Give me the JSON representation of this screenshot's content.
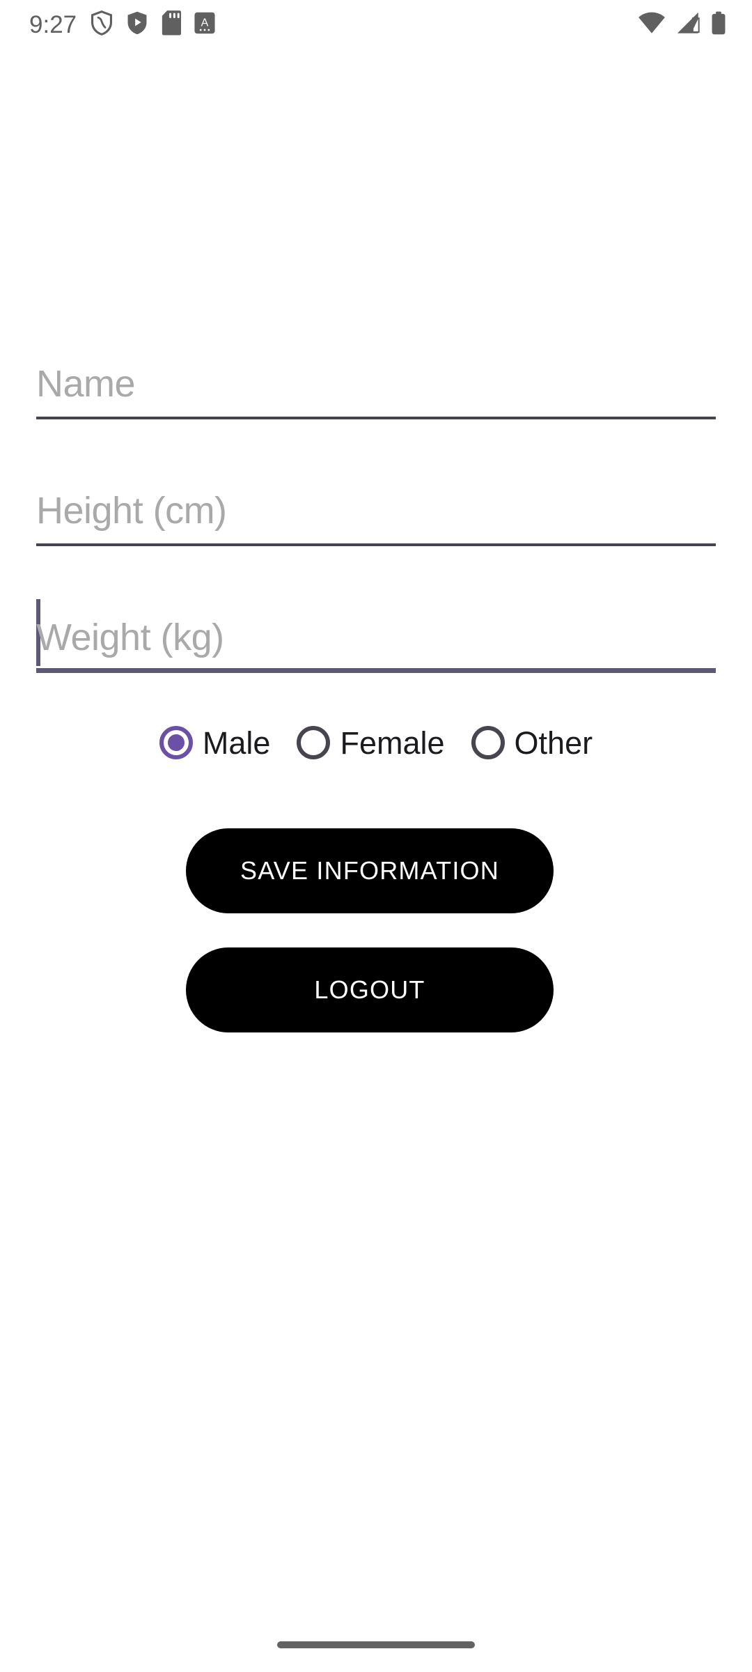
{
  "status_bar": {
    "time": "9:27",
    "left_icons": [
      {
        "name": "shield-outline-icon"
      },
      {
        "name": "shield-play-icon"
      },
      {
        "name": "sd-card-icon"
      },
      {
        "name": "document-a-icon"
      }
    ],
    "right_icons": [
      {
        "name": "wifi-icon"
      },
      {
        "name": "cellular-signal-icon"
      },
      {
        "name": "battery-icon"
      }
    ]
  },
  "form": {
    "fields": [
      {
        "id": "name",
        "placeholder": "Name",
        "value": "",
        "focused": false
      },
      {
        "id": "height",
        "placeholder": "Height (cm)",
        "value": "",
        "focused": false
      },
      {
        "id": "weight",
        "placeholder": "Weight (kg)",
        "value": "",
        "focused": true
      }
    ],
    "gender": {
      "selected": "Male",
      "options": [
        {
          "label": "Male",
          "selected": true
        },
        {
          "label": "Female",
          "selected": false
        },
        {
          "label": "Other",
          "selected": false
        }
      ]
    },
    "buttons": {
      "save_label": "SAVE INFORMATION",
      "logout_label": "LOGOUT"
    }
  },
  "colors": {
    "accent_purple": "#6a51a6",
    "focused_underline": "#5d5878",
    "underline": "#46444f",
    "button_bg": "#000000",
    "button_text": "#ffffff",
    "placeholder_text": "#a9a9a9",
    "label_text": "#1b1b1f",
    "status_icon": "#606060",
    "background": "#ffffff"
  }
}
